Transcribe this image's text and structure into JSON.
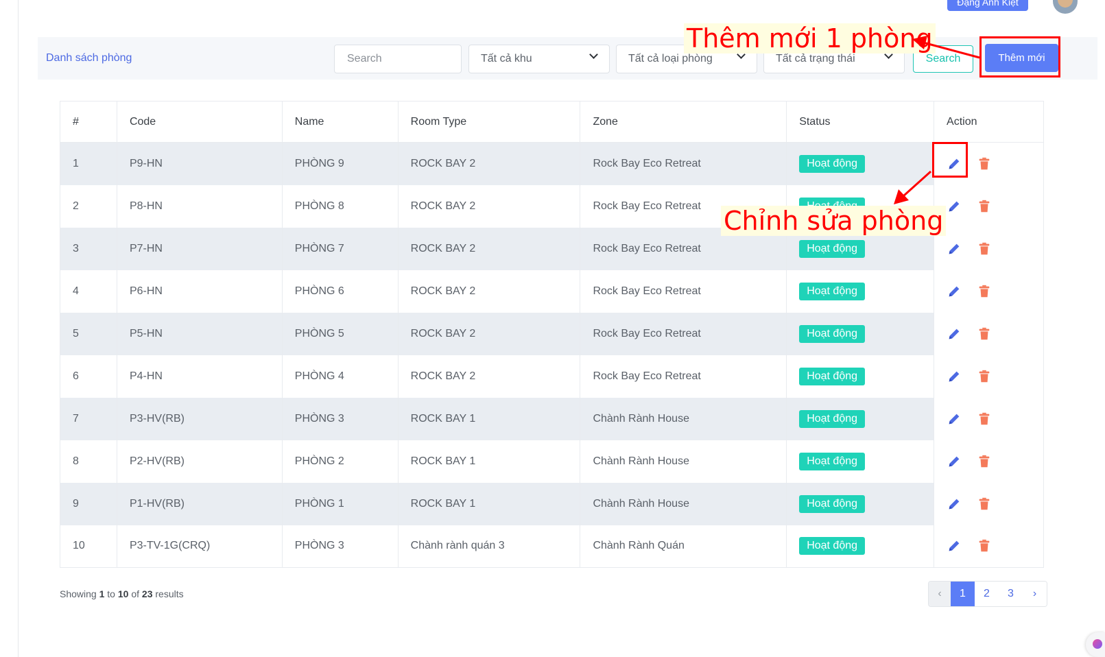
{
  "header": {
    "user_name": "Đặng Anh Kiệt"
  },
  "toolbar": {
    "title": "Danh sách phòng",
    "search_placeholder": "Search",
    "zone_filter": "Tất cả khu",
    "room_type_filter": "Tất cả loại phòng",
    "status_filter": "Tất cả trạng thái",
    "search_button": "Search",
    "add_button": "Thêm mới"
  },
  "table": {
    "headers": [
      "#",
      "Code",
      "Name",
      "Room Type",
      "Zone",
      "Status",
      "Action"
    ],
    "rows": [
      {
        "no": "1",
        "code": "P9-HN",
        "name": "PHÒNG 9",
        "room_type": "ROCK BAY 2",
        "zone": "Rock Bay Eco Retreat",
        "status": "Hoạt động"
      },
      {
        "no": "2",
        "code": "P8-HN",
        "name": "PHÒNG 8",
        "room_type": "ROCK BAY 2",
        "zone": "Rock Bay Eco Retreat",
        "status": "Hoạt động"
      },
      {
        "no": "3",
        "code": "P7-HN",
        "name": "PHÒNG 7",
        "room_type": "ROCK BAY 2",
        "zone": "Rock Bay Eco Retreat",
        "status": "Hoạt động"
      },
      {
        "no": "4",
        "code": "P6-HN",
        "name": "PHÒNG 6",
        "room_type": "ROCK BAY 2",
        "zone": "Rock Bay Eco Retreat",
        "status": "Hoạt động"
      },
      {
        "no": "5",
        "code": "P5-HN",
        "name": "PHÒNG 5",
        "room_type": "ROCK BAY 2",
        "zone": "Rock Bay Eco Retreat",
        "status": "Hoạt động"
      },
      {
        "no": "6",
        "code": "P4-HN",
        "name": "PHÒNG 4",
        "room_type": "ROCK BAY 2",
        "zone": "Rock Bay Eco Retreat",
        "status": "Hoạt động"
      },
      {
        "no": "7",
        "code": "P3-HV(RB)",
        "name": "PHÒNG 3",
        "room_type": "ROCK BAY 1",
        "zone": "Chành Rành House",
        "status": "Hoạt động"
      },
      {
        "no": "8",
        "code": "P2-HV(RB)",
        "name": "PHÒNG 2",
        "room_type": "ROCK BAY 1",
        "zone": "Chành Rành House",
        "status": "Hoạt động"
      },
      {
        "no": "9",
        "code": "P1-HV(RB)",
        "name": "PHÒNG 1",
        "room_type": "ROCK BAY 1",
        "zone": "Chành Rành House",
        "status": "Hoạt động"
      },
      {
        "no": "10",
        "code": "P3-TV-1G(CRQ)",
        "name": "PHÒNG 3",
        "room_type": "Chành rành quán 3",
        "zone": "Chành Rành Quán",
        "status": "Hoạt động"
      }
    ]
  },
  "footer": {
    "showing_prefix": "Showing",
    "from": "1",
    "to_word": "to",
    "to": "10",
    "of_word": "of",
    "total": "23",
    "suffix": "results"
  },
  "pagination": {
    "prev": "‹",
    "pages": [
      "1",
      "2",
      "3"
    ],
    "current": "1",
    "next": "›"
  },
  "annotations": {
    "add_note": "Thêm mới 1 phòng",
    "edit_note": "Chỉnh sửa phòng"
  },
  "colors": {
    "primary": "#5b7df6",
    "status_active": "#1fd3b8",
    "delete": "#f47a5a",
    "annotation": "#ff0000"
  },
  "icons": {
    "edit": "pencil-icon",
    "delete": "trash-icon",
    "dropdown": "chevron-down-icon"
  }
}
